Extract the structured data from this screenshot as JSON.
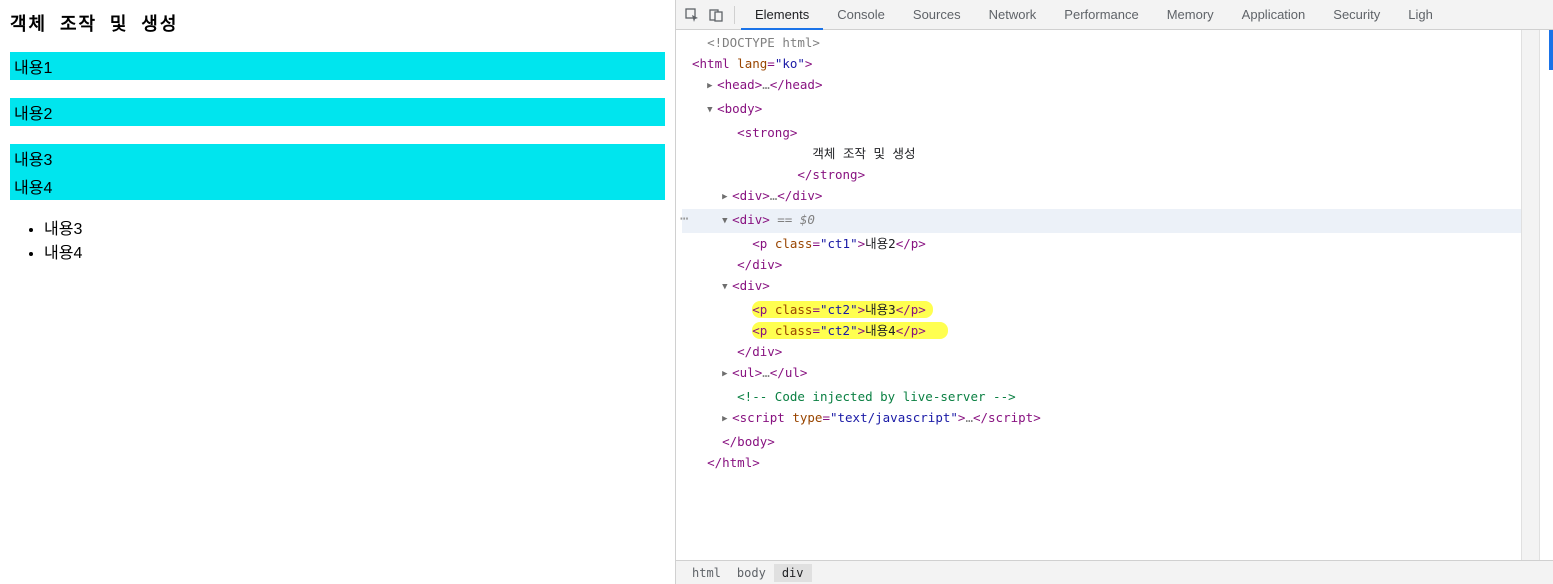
{
  "page": {
    "heading": "객체 조작 및 생성",
    "blocks": [
      "내용1",
      "내용2",
      "내용3",
      "내용4"
    ],
    "list": [
      "내용3",
      "내용4"
    ]
  },
  "devtools": {
    "tabs": [
      "Elements",
      "Console",
      "Sources",
      "Network",
      "Performance",
      "Memory",
      "Application",
      "Security",
      "Ligh"
    ],
    "active_tab": "Elements",
    "breadcrumb": [
      "html",
      "body",
      "div"
    ],
    "dom": {
      "doctype": "<!DOCTYPE html>",
      "html_open": "html",
      "html_lang_attr": "lang",
      "html_lang_val": "\"ko\"",
      "head": "head",
      "ellipsis": "…",
      "body": "body",
      "strong": "strong",
      "strong_text": "객체 조작 및 생성",
      "div": "div",
      "eq0": " == $0",
      "p": "p",
      "class_attr": "class",
      "ct1_val": "\"ct1\"",
      "ct2_val": "\"ct2\"",
      "p_text1": "내용2",
      "p_text2": "내용3",
      "p_text3": "내용4",
      "ul": "ul",
      "comment": " Code injected by live-server ",
      "script": "script",
      "type_attr": "type",
      "type_val": "\"text/javascript\""
    }
  }
}
